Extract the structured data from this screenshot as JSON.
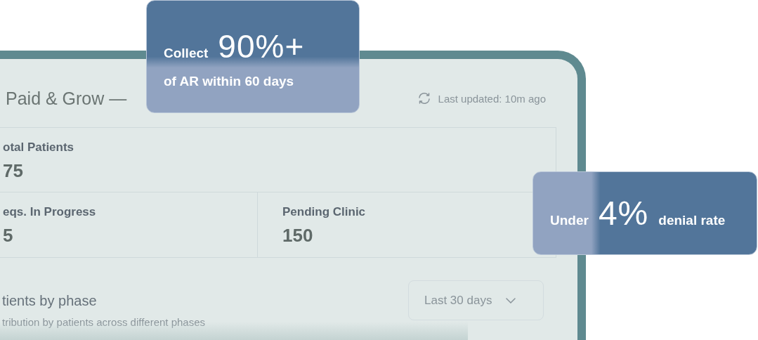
{
  "dashboard": {
    "title": "Paid & Grow —",
    "last_updated": "Last updated: 10m ago",
    "stats": [
      {
        "label": "otal Patients",
        "value": "75"
      },
      {
        "label": "eqs. In Progress",
        "value": "5"
      },
      {
        "label": "Pending Clinic",
        "value": "150"
      }
    ],
    "section": {
      "title": "tients by phase",
      "subtitle": "tribution by patients across different phases",
      "range": "Last 30 days"
    }
  },
  "callouts": [
    {
      "kind": "stacked",
      "lead": "Collect",
      "figure": "90%+",
      "tail": "of AR within 60 days"
    },
    {
      "kind": "inline",
      "lead": "Under",
      "figure": "4%",
      "tail": "denial rate"
    }
  ]
}
